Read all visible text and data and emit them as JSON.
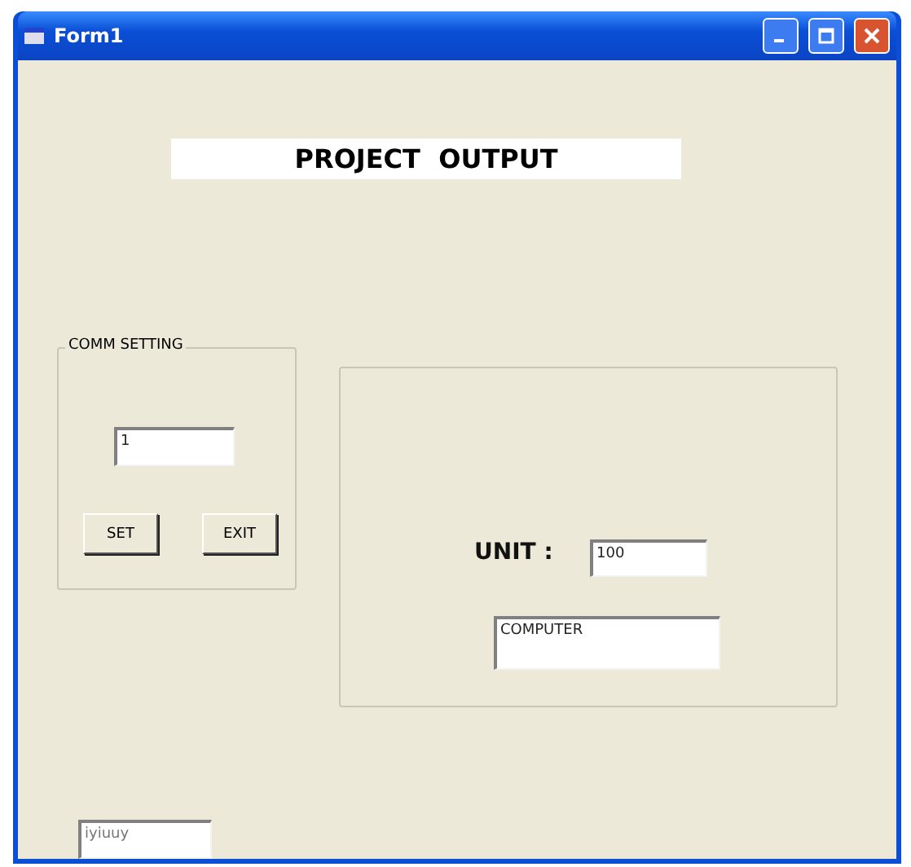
{
  "window": {
    "title": "Form1"
  },
  "heading": "PROJECT  OUTPUT",
  "comm_setting": {
    "title": "COMM SETTING",
    "port_value": "1",
    "buttons": [
      "SET",
      "EXIT"
    ]
  },
  "output": {
    "unit_label": "UNIT :",
    "unit_value": "100",
    "source_value": "COMPUTER"
  },
  "bottom_field": {
    "value": "iyiuuy"
  }
}
